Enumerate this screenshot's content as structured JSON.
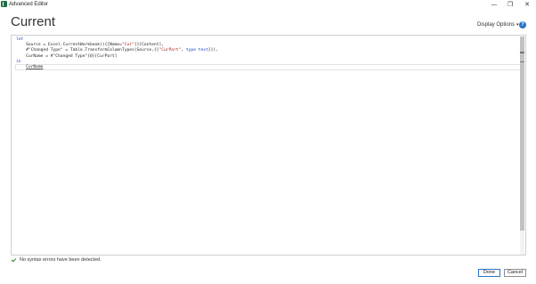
{
  "window": {
    "title": "Advanced Editor",
    "controls": {
      "minimize": "—",
      "restore": "❐",
      "close": "✕"
    },
    "app_icon": "excel-icon"
  },
  "header": {
    "title": "Current",
    "display_options_label": "Display Options",
    "display_options_caret": "▾",
    "help_label": "?"
  },
  "editor": {
    "lines": [
      {
        "indent": "",
        "parts": [
          {
            "t": "let",
            "c": "kw"
          }
        ]
      },
      {
        "indent": "    ",
        "parts": [
          {
            "t": "Source = Excel.CurrentWorkbook(){[Name=",
            "c": ""
          },
          {
            "t": "\"Cur\"",
            "c": "str"
          },
          {
            "t": "]}[Content],",
            "c": ""
          }
        ]
      },
      {
        "indent": "    ",
        "parts": [
          {
            "t": "#\"Changed Type\" = Table.TransformColumnTypes(Source,{{",
            "c": ""
          },
          {
            "t": "\"CurPart\"",
            "c": "str"
          },
          {
            "t": ", ",
            "c": ""
          },
          {
            "t": "type text",
            "c": "kw"
          },
          {
            "t": "}}),",
            "c": ""
          }
        ]
      },
      {
        "indent": "    ",
        "parts": [
          {
            "t": "CurName = #\"Changed Type\"{0}[CurPart]",
            "c": ""
          }
        ]
      },
      {
        "indent": "",
        "parts": [
          {
            "t": "in",
            "c": "kw"
          }
        ]
      },
      {
        "indent": "    ",
        "parts": [
          {
            "t": "CurName",
            "c": "cur-token"
          }
        ]
      }
    ]
  },
  "status": {
    "message": "No syntax errors have been detected."
  },
  "footer": {
    "done_label": "Done",
    "cancel_label": "Cancel"
  },
  "colors": {
    "keyword": "#1b40c7",
    "string": "#a31515",
    "accent": "#2b73c9",
    "excel_green": "#1e7145"
  }
}
